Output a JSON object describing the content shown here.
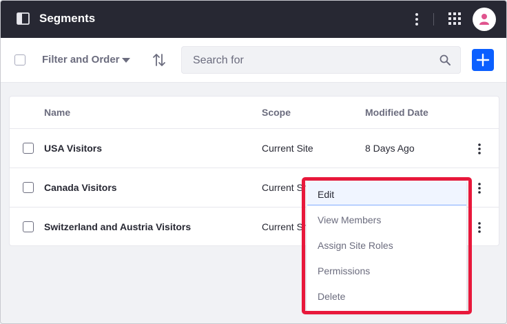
{
  "app": {
    "title": "Segments"
  },
  "icons": {
    "panel": "sidebar-toggle-icon",
    "more": "vertical-ellipsis-icon",
    "apps": "apps-grid-icon",
    "user": "user-avatar-icon",
    "sort": "sort-order-icon",
    "search": "magnifier-icon",
    "add": "plus-icon"
  },
  "colors": {
    "topbar": "#272833",
    "primary": "#0b5fff",
    "avatar_icon": "#e0548e",
    "highlight": "#e8183b"
  },
  "toolbar": {
    "filter_label": "Filter and Order",
    "search_placeholder": "Search for"
  },
  "table": {
    "columns": [
      "Name",
      "Scope",
      "Modified Date"
    ],
    "rows": [
      {
        "name": "USA Visitors",
        "scope": "Current Site",
        "date": "8 Days Ago"
      },
      {
        "name": "Canada Visitors",
        "scope": "Current Site",
        "date": ""
      },
      {
        "name": "Switzerland and Austria Visitors",
        "scope": "Current Site",
        "date": ""
      }
    ]
  },
  "dropdown": {
    "items": [
      "Edit",
      "View Members",
      "Assign Site Roles",
      "Permissions",
      "Delete"
    ],
    "active_index": 0
  }
}
